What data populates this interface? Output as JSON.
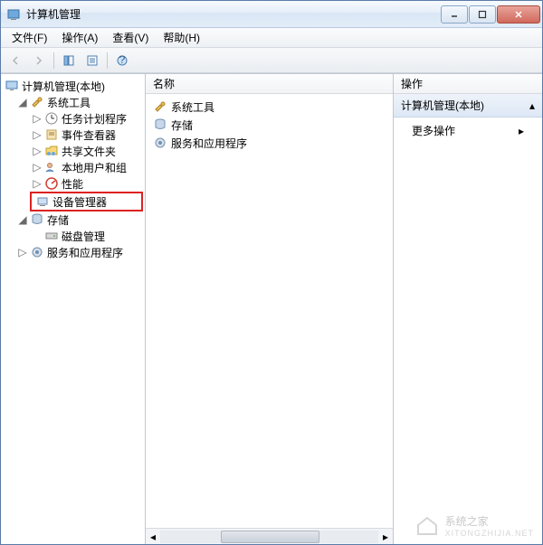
{
  "window": {
    "title": "计算机管理"
  },
  "menu": {
    "file": "文件(F)",
    "action": "操作(A)",
    "view": "查看(V)",
    "help": "帮助(H)"
  },
  "tree": {
    "root": "计算机管理(本地)",
    "system_tools": "系统工具",
    "task_scheduler": "任务计划程序",
    "event_viewer": "事件查看器",
    "shared_folders": "共享文件夹",
    "local_users": "本地用户和组",
    "performance": "性能",
    "device_manager": "设备管理器",
    "storage": "存储",
    "disk_mgmt": "磁盘管理",
    "services_apps": "服务和应用程序"
  },
  "middle": {
    "header": "名称",
    "items": {
      "system_tools": "系统工具",
      "storage": "存储",
      "services_apps": "服务和应用程序"
    }
  },
  "actions": {
    "header": "操作",
    "group": "计算机管理(本地)",
    "more": "更多操作"
  },
  "watermark": {
    "main": "系统之家",
    "sub": "XITONGZHIJIA.NET"
  }
}
